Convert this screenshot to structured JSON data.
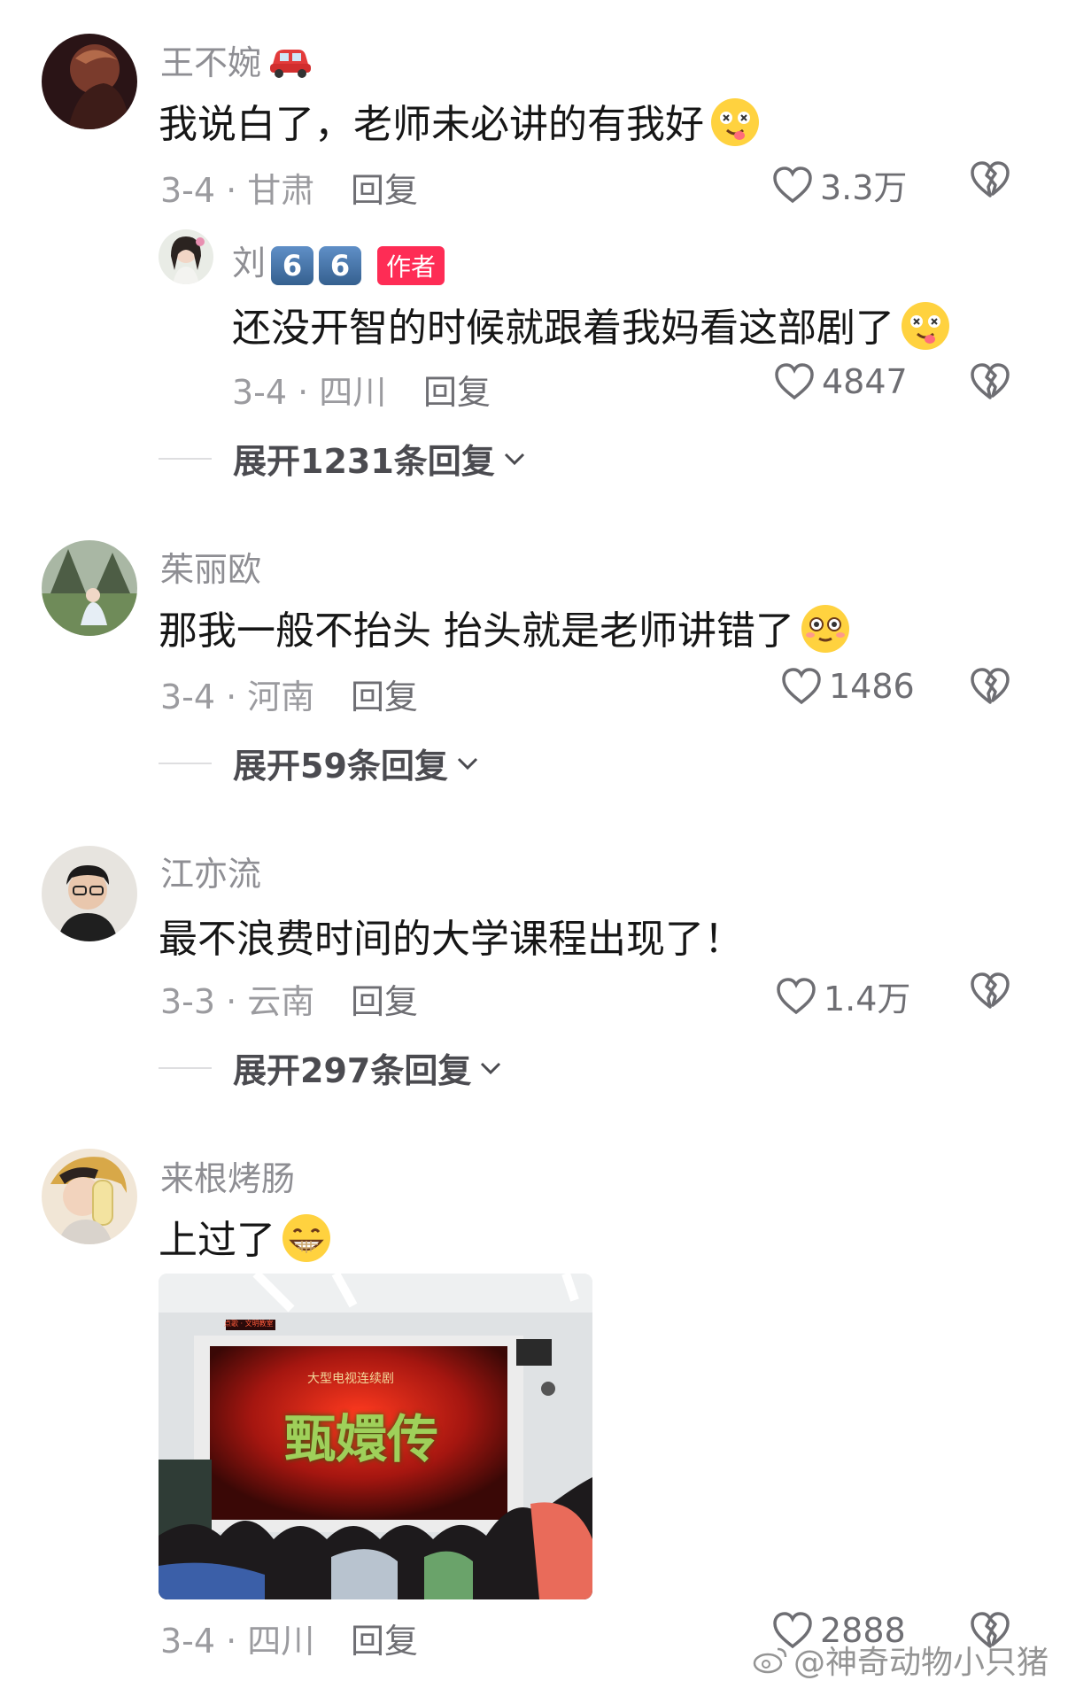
{
  "comments": [
    {
      "user": "王不婉",
      "text": "我说白了，老师未必讲的有我好",
      "date_location": "3-4 · 甘肃",
      "reply_label": "回复",
      "likes": "3.3万"
    },
    {
      "user": "茱丽欧",
      "text": "那我一般不抬头 抬头就是老师讲错了",
      "date_location": "3-4 · 河南",
      "reply_label": "回复",
      "likes": "1486",
      "expand_label": "展开59条回复"
    },
    {
      "user": "江亦流",
      "text": "最不浪费时间的大学课程出现了！",
      "date_location": "3-3 · 云南",
      "reply_label": "回复",
      "likes": "1.4万",
      "expand_label": "展开297条回复"
    },
    {
      "user": "来根烤肠",
      "text": "上过了",
      "date_location": "3-4 · 四川",
      "reply_label": "回复",
      "likes": "2888"
    }
  ],
  "reply": {
    "user": "刘",
    "badges": [
      "6",
      "6"
    ],
    "author_tag": "作者",
    "text": "还没开智的时候就跟着我妈看这部剧了",
    "date_location": "3-4 · 四川",
    "reply_label": "回复",
    "likes": "4847",
    "expand_label": "展开1231条回复"
  },
  "photo": {
    "led_sign": "点歌 · 文明教室",
    "title_banner": "大型电视连续剧",
    "title": "甄嬛传"
  },
  "watermark": "@神奇动物小只猪",
  "colors": {
    "accent_red": "#fe2c55",
    "meta_gray": "#9b9b9f",
    "name_gray": "#8e8e93"
  }
}
